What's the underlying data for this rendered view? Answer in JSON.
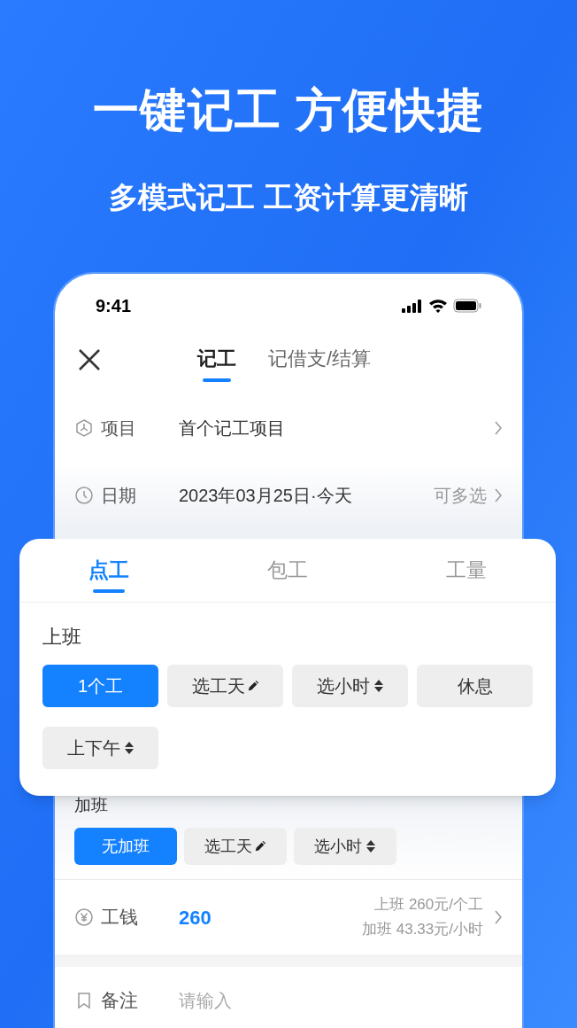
{
  "headline": "一键记工 方便快捷",
  "subheadline": "多模式记工 工资计算更清晰",
  "status_bar": {
    "time": "9:41"
  },
  "nav": {
    "tabs": [
      {
        "label": "记工",
        "selected": true
      },
      {
        "label": "记借支/结算",
        "selected": false
      }
    ]
  },
  "fields": [
    {
      "kind": "project",
      "label": "项目",
      "value": "首个记工项目"
    },
    {
      "kind": "date",
      "label": "日期",
      "value": "2023年03月25日·今天",
      "hint": "可多选"
    }
  ],
  "mode_card": {
    "tabs": [
      {
        "label": "点工",
        "selected": true
      },
      {
        "label": "包工",
        "selected": false
      },
      {
        "label": "工量",
        "selected": false
      }
    ],
    "section": "上班",
    "options": [
      {
        "label": "1个工",
        "selected": true,
        "kind": "plain"
      },
      {
        "label": "选工天",
        "selected": false,
        "kind": "edit"
      },
      {
        "label": "选小时",
        "selected": false,
        "kind": "stepper"
      },
      {
        "label": "休息",
        "selected": false,
        "kind": "plain"
      },
      {
        "label": "上下午",
        "selected": false,
        "kind": "stepper"
      }
    ]
  },
  "overtime": {
    "section": "加班",
    "options": [
      {
        "label": "无加班",
        "selected": true,
        "kind": "plain"
      },
      {
        "label": "选工天",
        "selected": false,
        "kind": "edit"
      },
      {
        "label": "选小时",
        "selected": false,
        "kind": "stepper"
      }
    ]
  },
  "wage": {
    "label": "工钱",
    "amount": "260",
    "details": [
      "上班 260元/个工",
      "加班 43.33元/小时"
    ]
  },
  "note": {
    "label": "备注",
    "placeholder": "请输入"
  }
}
